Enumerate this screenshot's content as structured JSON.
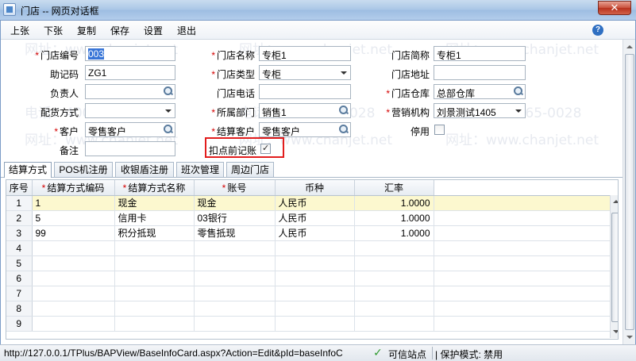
{
  "window": {
    "title": "门店 -- 网页对话框",
    "close_label": "✕"
  },
  "menu": {
    "items": [
      "上张",
      "下张",
      "复制",
      "保存",
      "设置",
      "退出"
    ],
    "help_label": "?"
  },
  "form": {
    "store_code": {
      "label": "门店编号",
      "value": "003"
    },
    "store_name": {
      "label": "门店名称",
      "value": "专柜1"
    },
    "store_short": {
      "label": "门店简称",
      "value": "专柜1"
    },
    "mnemonic": {
      "label": "助记码",
      "value": "ZG1"
    },
    "store_type": {
      "label": "门店类型",
      "value": "专柜"
    },
    "store_address": {
      "label": "门店地址",
      "value": ""
    },
    "manager": {
      "label": "负责人",
      "value": ""
    },
    "store_phone": {
      "label": "门店电话",
      "value": ""
    },
    "store_warehouse": {
      "label": "门店仓库",
      "value": "总部仓库"
    },
    "delivery_mode": {
      "label": "配货方式",
      "value": ""
    },
    "department": {
      "label": "所属部门",
      "value": "销售1"
    },
    "sales_org": {
      "label": "营销机构",
      "value": "刘景测试1405"
    },
    "customer": {
      "label": "客户",
      "value": "零售客户"
    },
    "settle_customer": {
      "label": "结算客户",
      "value": "零售客户"
    },
    "disabled": {
      "label": "停用"
    },
    "remark": {
      "label": "备注",
      "value": ""
    },
    "deduct_before_posting": {
      "label": "扣点前记账"
    }
  },
  "tabs": [
    "结算方式",
    "POS机注册",
    "收银盾注册",
    "班次管理",
    "周边门店"
  ],
  "grid": {
    "columns": [
      "序号",
      "结算方式编码",
      "结算方式名称",
      "账号",
      "币种",
      "汇率"
    ],
    "rows": [
      {
        "idx": "1",
        "code": "1",
        "name": "现金",
        "account": "现金",
        "currency": "人民币",
        "rate": "1.0000"
      },
      {
        "idx": "2",
        "code": "5",
        "name": "信用卡",
        "account": "03银行",
        "currency": "人民币",
        "rate": "1.0000"
      },
      {
        "idx": "3",
        "code": "99",
        "name": "积分抵现",
        "account": "零售抵现",
        "currency": "人民币",
        "rate": "1.0000"
      },
      {
        "idx": "4",
        "code": "",
        "name": "",
        "account": "",
        "currency": "",
        "rate": ""
      },
      {
        "idx": "5",
        "code": "",
        "name": "",
        "account": "",
        "currency": "",
        "rate": ""
      },
      {
        "idx": "6",
        "code": "",
        "name": "",
        "account": "",
        "currency": "",
        "rate": ""
      },
      {
        "idx": "7",
        "code": "",
        "name": "",
        "account": "",
        "currency": "",
        "rate": ""
      },
      {
        "idx": "8",
        "code": "",
        "name": "",
        "account": "",
        "currency": "",
        "rate": ""
      },
      {
        "idx": "9",
        "code": "",
        "name": "",
        "account": "",
        "currency": "",
        "rate": ""
      }
    ]
  },
  "watermark": {
    "phone": "电话：400-665-0028",
    "site": "网址：www.chanjet.net"
  },
  "status": {
    "url": "http://127.0.0.1/TPlus/BAPView/BaseInfoCard.aspx?Action=Edit&pId=baseInfoC",
    "trusted": "可信站点",
    "protected": "| 保护模式: 禁用"
  }
}
